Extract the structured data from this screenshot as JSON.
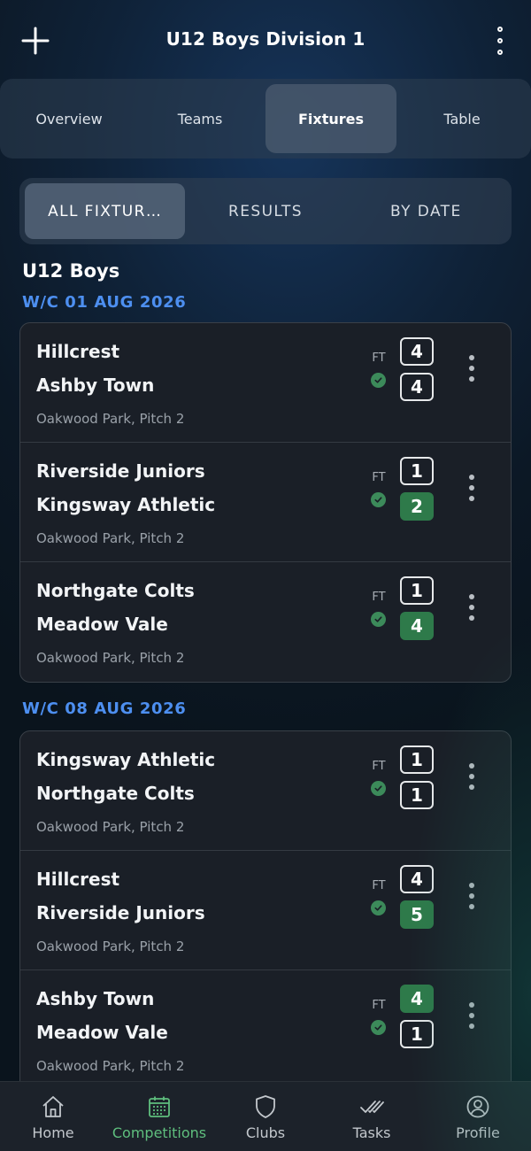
{
  "header": {
    "title": "U12 Boys Division 1",
    "add_icon": "plus-icon",
    "more_icon": "kebab-menu-icon"
  },
  "tabs": [
    {
      "label": "Overview",
      "active": false
    },
    {
      "label": "Teams",
      "active": false
    },
    {
      "label": "Fixtures",
      "active": true
    },
    {
      "label": "Table",
      "active": false
    }
  ],
  "filters": [
    {
      "label": "ALL FIXTUR…",
      "active": true
    },
    {
      "label": "RESULTS",
      "active": false
    },
    {
      "label": "BY DATE",
      "active": false
    }
  ],
  "group_title": "U12 Boys",
  "weeks": [
    {
      "label": "W/C 01 AUG 2026",
      "fixtures": [
        {
          "home": "Hillcrest",
          "away": "Ashby Town",
          "venue": "Oakwood Park, Pitch 2",
          "status": "FT",
          "home_score": "4",
          "away_score": "4",
          "winner": "none"
        },
        {
          "home": "Riverside Juniors",
          "away": "Kingsway Athletic",
          "venue": "Oakwood Park, Pitch 2",
          "status": "FT",
          "home_score": "1",
          "away_score": "2",
          "winner": "away"
        },
        {
          "home": "Northgate Colts",
          "away": "Meadow Vale",
          "venue": "Oakwood Park, Pitch 2",
          "status": "FT",
          "home_score": "1",
          "away_score": "4",
          "winner": "away"
        }
      ]
    },
    {
      "label": "W/C 08 AUG 2026",
      "fixtures": [
        {
          "home": "Kingsway Athletic",
          "away": "Northgate Colts",
          "venue": "Oakwood Park, Pitch 2",
          "status": "FT",
          "home_score": "1",
          "away_score": "1",
          "winner": "none"
        },
        {
          "home": "Hillcrest",
          "away": "Riverside Juniors",
          "venue": "Oakwood Park, Pitch 2",
          "status": "FT",
          "home_score": "4",
          "away_score": "5",
          "winner": "away"
        },
        {
          "home": "Ashby Town",
          "away": "Meadow Vale",
          "venue": "Oakwood Park, Pitch 2",
          "status": "FT",
          "home_score": "4",
          "away_score": "1",
          "winner": "home"
        }
      ]
    }
  ],
  "bottom_nav": [
    {
      "label": "Home",
      "icon": "home-icon",
      "active": false
    },
    {
      "label": "Competitions",
      "icon": "calendar-icon",
      "active": true
    },
    {
      "label": "Clubs",
      "icon": "shield-icon",
      "active": false
    },
    {
      "label": "Tasks",
      "icon": "double-check-icon",
      "active": false
    },
    {
      "label": "Profile",
      "icon": "user-icon",
      "active": false
    }
  ],
  "colors": {
    "accent_blue": "#4d8ff0",
    "win_green": "#2e7a4a",
    "nav_active": "#5fbf7e",
    "card_bg": "#1a1f27"
  }
}
